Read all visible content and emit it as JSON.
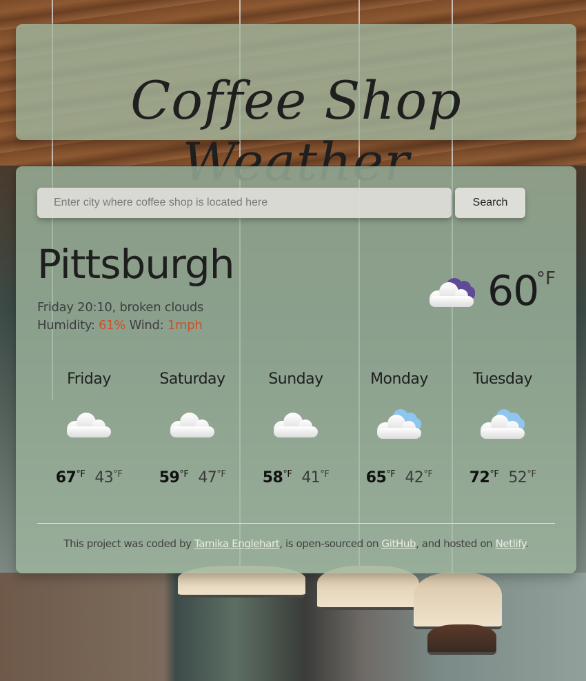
{
  "app": {
    "title": "Coffee Shop Weather"
  },
  "search": {
    "placeholder": "Enter city where coffee shop is located here",
    "value": "",
    "button_label": "Search"
  },
  "current": {
    "city": "Pittsburgh",
    "day_time": "Friday 20:10",
    "description": "broken clouds",
    "humidity_label": "Humidity:",
    "humidity_value": "61%",
    "wind_label": "Wind:",
    "wind_value": "1mph",
    "temperature": "60",
    "unit": "°F",
    "icon": "broken-clouds-night-icon"
  },
  "forecast": [
    {
      "day": "Friday",
      "icon": "cloudy-icon",
      "max": "67",
      "min": "43",
      "unit": "°F"
    },
    {
      "day": "Saturday",
      "icon": "cloudy-icon",
      "max": "59",
      "min": "47",
      "unit": "°F"
    },
    {
      "day": "Sunday",
      "icon": "cloudy-icon",
      "max": "58",
      "min": "41",
      "unit": "°F"
    },
    {
      "day": "Monday",
      "icon": "partly-cloudy-icon",
      "max": "65",
      "min": "42",
      "unit": "°F"
    },
    {
      "day": "Tuesday",
      "icon": "partly-cloudy-icon",
      "max": "72",
      "min": "52",
      "unit": "°F"
    }
  ],
  "footer": {
    "text_1": "This project was coded by ",
    "author_link": "Tamika Englehart",
    "text_2": ", is open-sourced on ",
    "github_link": "GitHub",
    "text_3": ", and hosted on ",
    "netlify_link": "Netlify",
    "text_4": "."
  },
  "colors": {
    "accent": "#c8512a",
    "card": "#a0b9a0",
    "icon_night": "#5f4a9a",
    "icon_day": "#8ec6f0"
  }
}
